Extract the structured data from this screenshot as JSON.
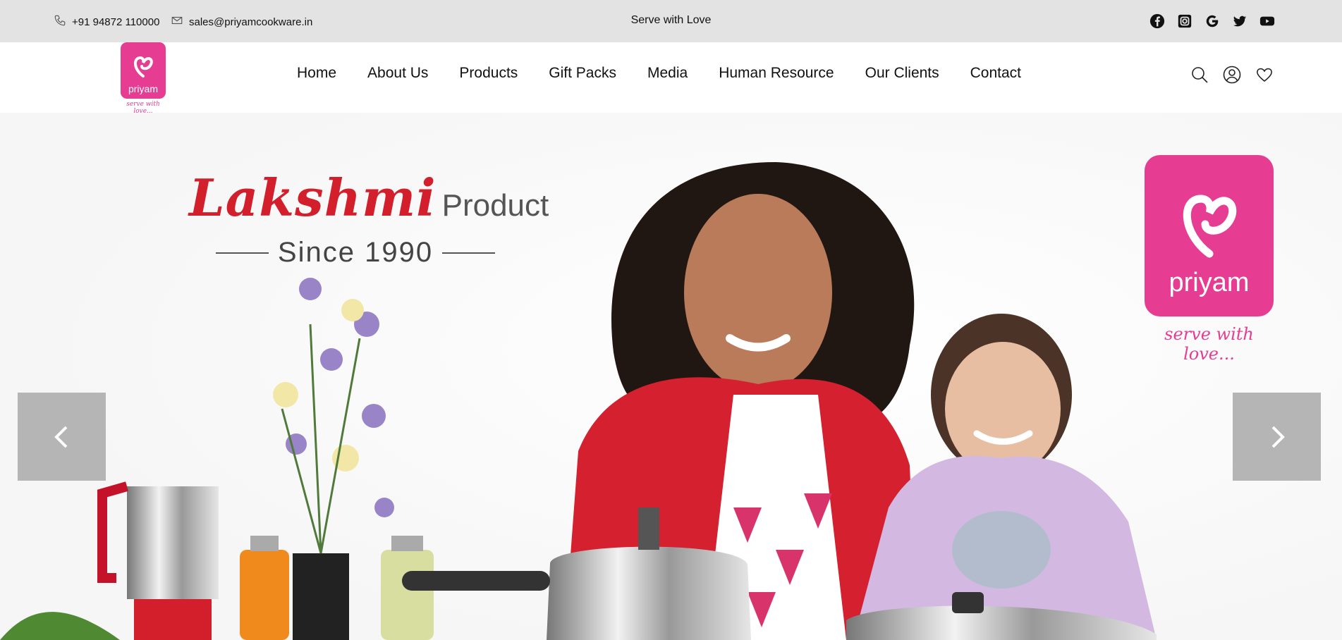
{
  "topbar": {
    "phone": "+91 94872 110000",
    "email": "sales@priyamcookware.in",
    "tagline": "Serve with Love",
    "social": [
      "facebook-icon",
      "instagram-icon",
      "google-icon",
      "twitter-icon",
      "youtube-icon"
    ]
  },
  "header": {
    "logo_label": "priyam",
    "logo_tag": "serve with love...",
    "nav": [
      "Home",
      "About Us",
      "Products",
      "Gift Packs",
      "Media",
      "Human Resource",
      "Our Clients",
      "Contact"
    ],
    "icons": [
      "search-icon",
      "user-icon",
      "heart-icon"
    ]
  },
  "hero": {
    "brand_name": "Lakshmi",
    "brand_suffix": "Product",
    "since": "Since 1990",
    "logo_label": "priyam",
    "logo_tag": "serve with love...",
    "prev_icon": "chevron-left-icon",
    "next_icon": "chevron-right-icon"
  },
  "colors": {
    "brand_pink": "#e63d93",
    "brand_red": "#d21f2b",
    "topbar_bg": "#e3e3e3",
    "arrow_bg": "#b5b5b5"
  }
}
